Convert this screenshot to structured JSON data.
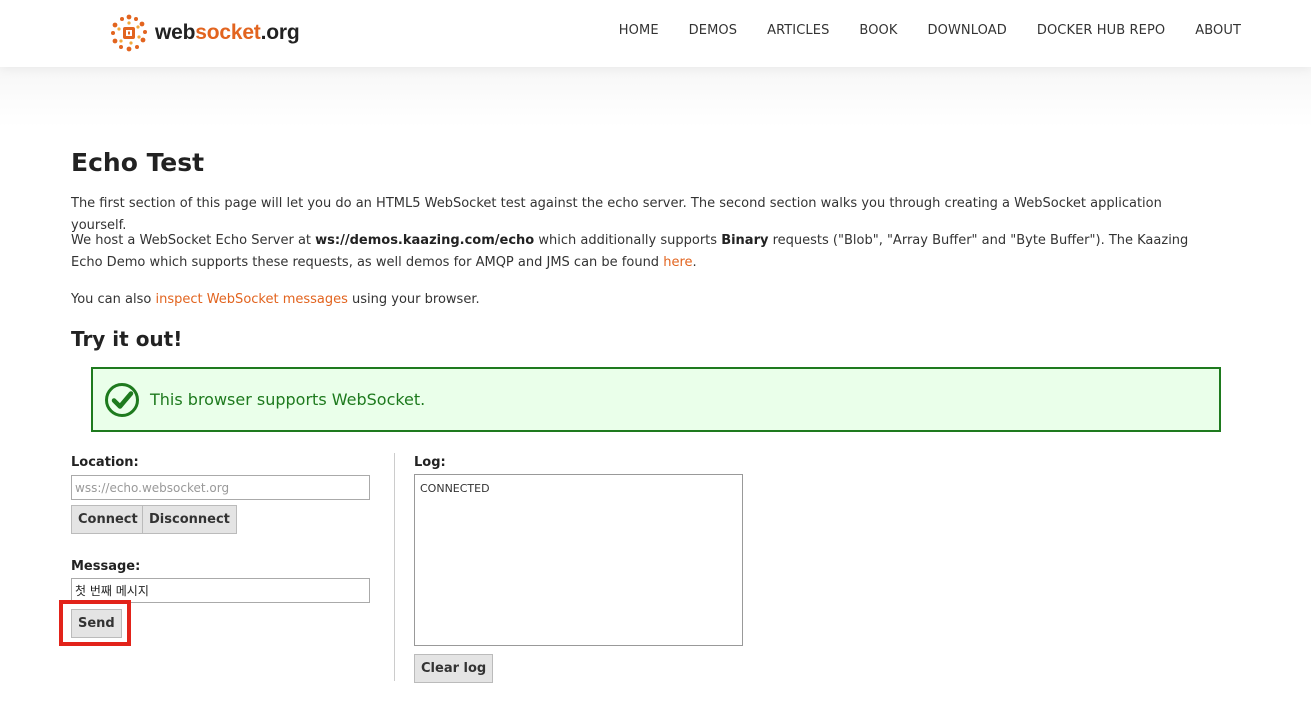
{
  "header": {
    "logo": {
      "part1": "web",
      "part2": "socket",
      "part3": ".org",
      "icon": "websocket-logo-icon"
    },
    "nav": [
      "HOME",
      "DEMOS",
      "ARTICLES",
      "BOOK",
      "DOWNLOAD",
      "DOCKER HUB REPO",
      "ABOUT"
    ]
  },
  "main": {
    "title": "Echo Test",
    "intro": "The first section of this page will let you do an HTML5 WebSocket test against the echo server. The second section walks you through creating a WebSocket application yourself.",
    "host": {
      "t1": "We host a WebSocket Echo Server at ",
      "server": "ws://demos.kaazing.com/echo",
      "t2": " which additionally supports ",
      "binary": "Binary",
      "t3": " requests (\"Blob\", \"Array Buffer\" and \"Byte Buffer\"). The Kaazing Echo Demo which supports these requests, as well demos for AMQP and JMS can be found ",
      "link": "here",
      "t4": "."
    },
    "inspect": {
      "t1": "You can also ",
      "link": "inspect WebSocket messages",
      "t2": " using your browser."
    },
    "try_title": "Try it out!",
    "support_text": "This browser supports WebSocket.",
    "location": {
      "label": "Location:",
      "placeholder": "wss://echo.websocket.org",
      "value": ""
    },
    "connect_label": "Connect",
    "disconnect_label": "Disconnect",
    "message": {
      "label": "Message:",
      "value": "첫 번째 메시지"
    },
    "send_label": "Send",
    "log": {
      "label": "Log:",
      "content": "CONNECTED"
    },
    "clear_label": "Clear log"
  },
  "colors": {
    "accent": "#e2641f",
    "success": "#1e7a1e",
    "success_bg": "#eaffea",
    "highlight": "#e2231a"
  }
}
